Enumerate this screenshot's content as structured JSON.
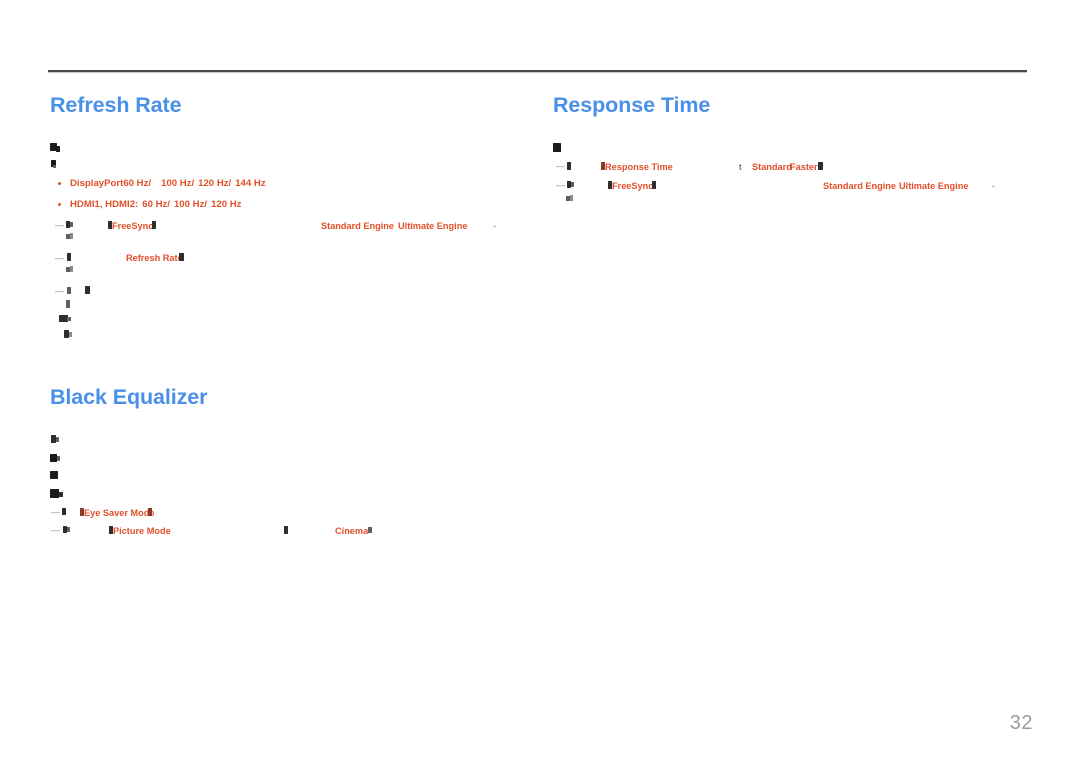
{
  "document": {
    "page_number": "32",
    "accent_heading_color": "#4a90e8",
    "accent_body_color": "#e2502a",
    "rule_color": "#4a4a4a",
    "page_number_color": "#9b9b9b",
    "background": "#ffffff"
  },
  "sections": {
    "refresh_rate": {
      "title": "Refresh Rate",
      "bullets": [
        {
          "source": "DisplayPort",
          "rates": [
            "60 Hz",
            "100 Hz",
            "120 Hz",
            "144 Hz"
          ],
          "separator": "/"
        },
        {
          "source": "HDMI1, HDMI2",
          "source_suffix": ":",
          "rates": [
            "60 Hz",
            "100 Hz",
            "120 Hz"
          ],
          "separator": "/"
        }
      ],
      "notes": [
        {
          "terms": [
            "FreeSync"
          ],
          "values": [
            "Standard Engine",
            "Ultimate Engine"
          ],
          "trailing": "-"
        },
        {
          "terms": [
            "Refresh Rate"
          ],
          "values": []
        },
        {
          "terms": [],
          "values": []
        }
      ]
    },
    "response_time": {
      "title": "Response Time",
      "notes": [
        {
          "terms": [
            "Response Time"
          ],
          "mid_marker": "t",
          "values": [
            "Standard",
            "Faster"
          ]
        },
        {
          "terms": [
            "FreeSync"
          ],
          "values": [
            "Standard Engine",
            "Ultimate Engine"
          ],
          "trailing": "-"
        }
      ]
    },
    "black_equalizer": {
      "title": "Black Equalizer",
      "notes": [
        {
          "terms": [
            "Eye Saver Mode"
          ],
          "values": []
        },
        {
          "terms": [
            "Picture Mode"
          ],
          "values": [
            "Cinema"
          ]
        }
      ]
    }
  }
}
